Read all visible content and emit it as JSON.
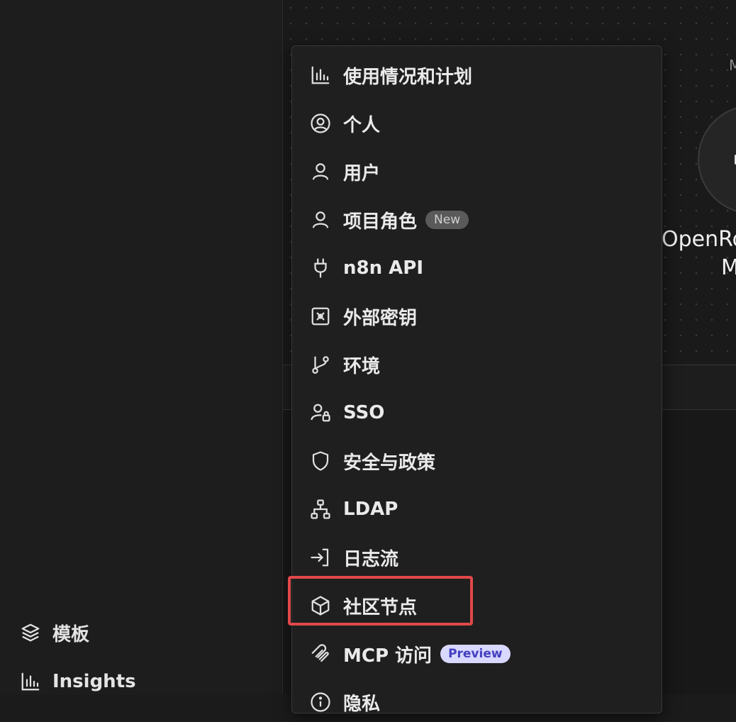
{
  "sidebar": {
    "items": [
      {
        "label": "模板",
        "icon": "templates-icon"
      },
      {
        "label": "Insights",
        "icon": "bar-chart-icon"
      }
    ]
  },
  "card": {
    "tag_partial": "M",
    "title_partial": "OpenRo",
    "subtitle_partial": "M"
  },
  "settings_menu": {
    "items": [
      {
        "label": "使用情况和计划",
        "icon": "bar-chart-icon"
      },
      {
        "label": "个人",
        "icon": "user-circle-icon"
      },
      {
        "label": "用户",
        "icon": "user-icon"
      },
      {
        "label": "项目角色",
        "icon": "user-icon",
        "badge": "New"
      },
      {
        "label": "n8n API",
        "icon": "plug-icon"
      },
      {
        "label": "外部密钥",
        "icon": "vault-icon"
      },
      {
        "label": "环境",
        "icon": "git-branch-icon"
      },
      {
        "label": "SSO",
        "icon": "user-lock-icon"
      },
      {
        "label": "安全与政策",
        "icon": "shield-icon"
      },
      {
        "label": "LDAP",
        "icon": "network-icon"
      },
      {
        "label": "日志流",
        "icon": "sign-in-icon"
      },
      {
        "label": "社区节点",
        "icon": "cube-icon",
        "highlighted": true
      },
      {
        "label": "MCP 访问",
        "icon": "mcp-icon",
        "badge": "Preview"
      },
      {
        "label": "隐私",
        "icon": "info-icon"
      }
    ]
  },
  "colors": {
    "background": "#1b1b1b",
    "menu_background": "#1f1f1f",
    "highlight": "#e04848",
    "preview_badge_bg": "#d9d8ff",
    "preview_badge_text": "#4340c0"
  }
}
